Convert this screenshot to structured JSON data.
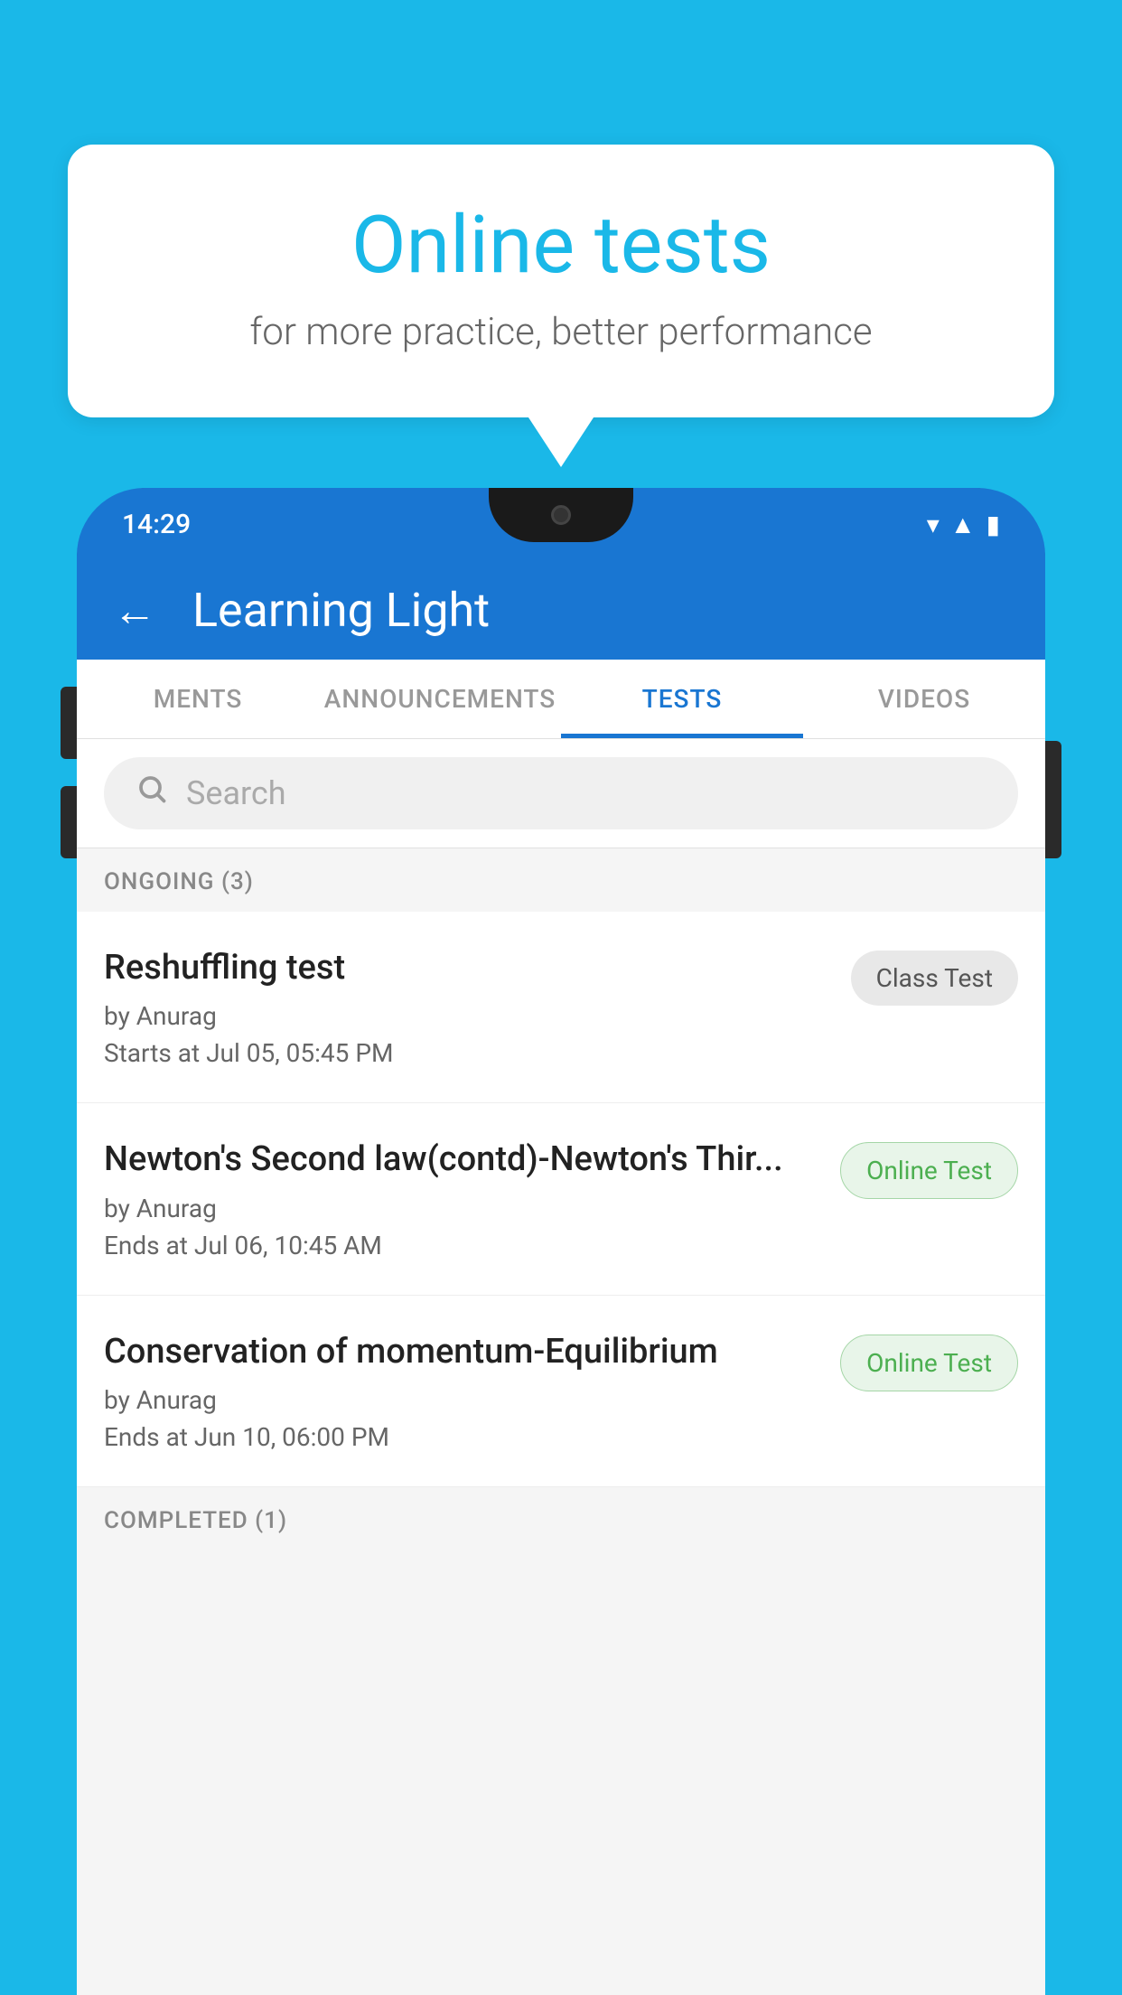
{
  "background_color": "#1ab8e8",
  "bubble": {
    "title": "Online tests",
    "subtitle": "for more practice, better performance"
  },
  "phone": {
    "status_bar": {
      "time": "14:29",
      "icons": [
        "wifi",
        "signal",
        "battery"
      ]
    },
    "app_bar": {
      "title": "Learning Light",
      "back_label": "←"
    },
    "tabs": [
      {
        "label": "MENTS",
        "active": false
      },
      {
        "label": "ANNOUNCEMENTS",
        "active": false
      },
      {
        "label": "TESTS",
        "active": true
      },
      {
        "label": "VIDEOS",
        "active": false
      }
    ],
    "search": {
      "placeholder": "Search"
    },
    "sections": [
      {
        "label": "ONGOING (3)",
        "tests": [
          {
            "title": "Reshuffling test",
            "author": "by Anurag",
            "time_label": "Starts at",
            "time": "Jul 05, 05:45 PM",
            "badge": "Class Test",
            "badge_type": "class"
          },
          {
            "title": "Newton's Second law(contd)-Newton's Thir...",
            "author": "by Anurag",
            "time_label": "Ends at",
            "time": "Jul 06, 10:45 AM",
            "badge": "Online Test",
            "badge_type": "online"
          },
          {
            "title": "Conservation of momentum-Equilibrium",
            "author": "by Anurag",
            "time_label": "Ends at",
            "time": "Jun 10, 06:00 PM",
            "badge": "Online Test",
            "badge_type": "online"
          }
        ]
      }
    ],
    "completed_label": "COMPLETED (1)"
  }
}
